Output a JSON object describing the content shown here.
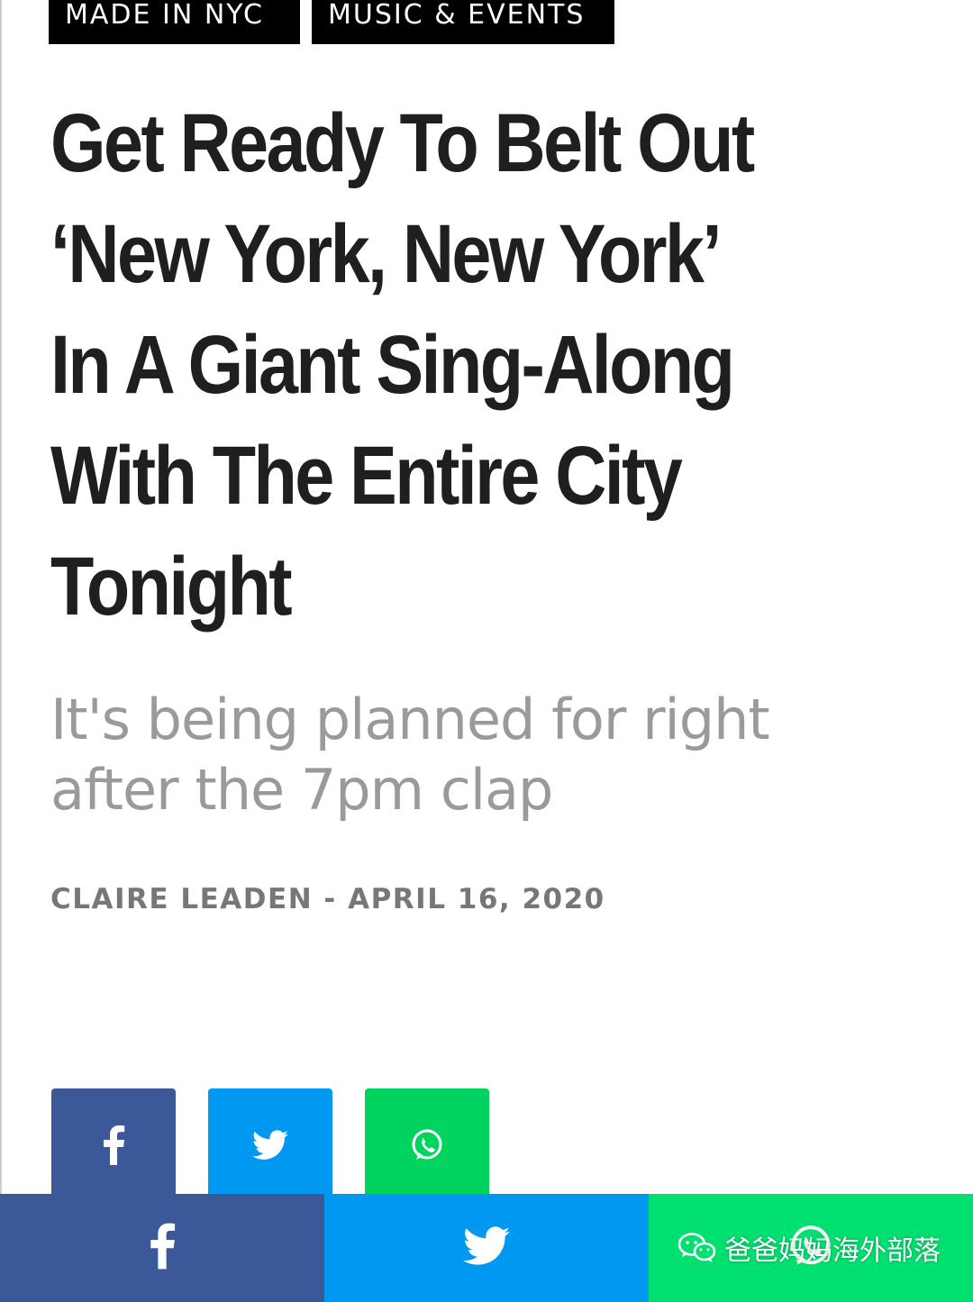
{
  "tags": [
    "MADE IN NYC",
    "MUSIC & EVENTS"
  ],
  "article": {
    "headline_lines": [
      "Get Ready To Belt Out",
      "‘New York, New York’",
      "In A Giant Sing-Along",
      "With The Entire City",
      "Tonight"
    ],
    "subtitle_lines": [
      "It's being planned for right",
      "after the 7pm clap"
    ],
    "byline": "CLAIRE LEADEN - APRIL 16, 2020"
  },
  "share": {
    "icons": [
      "facebook-icon",
      "twitter-icon",
      "whatsapp-icon"
    ]
  },
  "colors": {
    "facebook": "#3b5998",
    "twitter": "#0098f0",
    "whatsapp": "#00d35e",
    "tag_bg": "#000000",
    "headline": "#1f1f1f",
    "subtitle": "#9a9a9a",
    "byline": "#777777"
  },
  "watermark": {
    "text": "爸爸妈妈海外部落",
    "icon": "wechat-icon"
  }
}
